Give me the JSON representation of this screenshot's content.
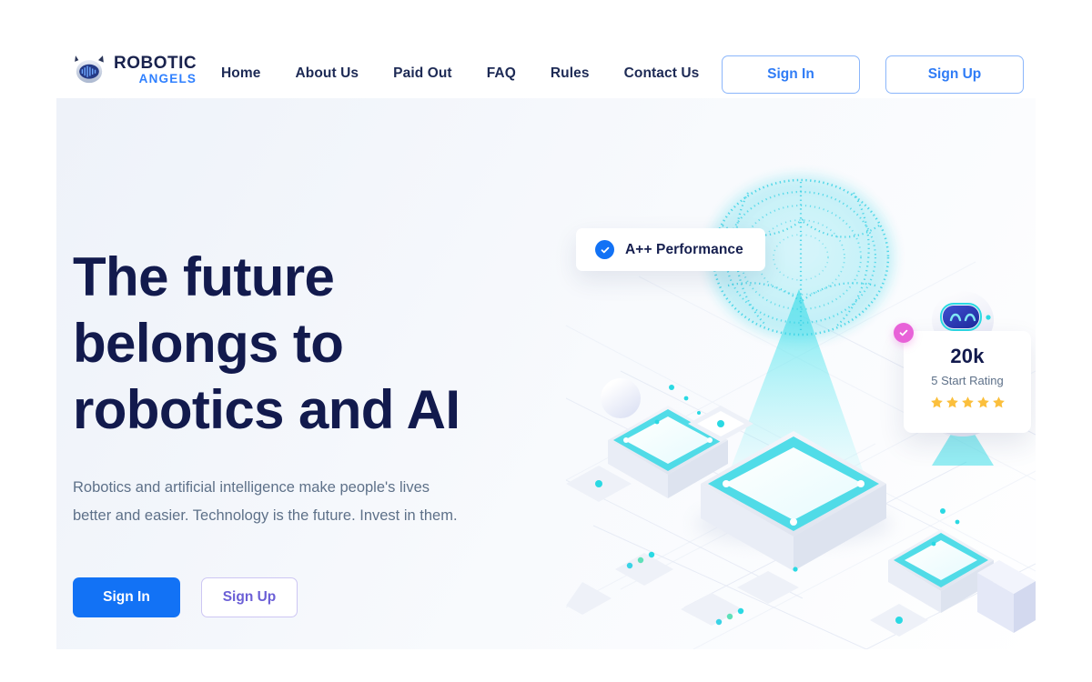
{
  "brand": {
    "name_top": "ROBOTIC",
    "name_bottom": "ANGELS",
    "icon": "robot-head-icon",
    "color_top": "#19224d",
    "color_bottom": "#2f80ff"
  },
  "nav": {
    "items": [
      {
        "label": "Home"
      },
      {
        "label": "About Us"
      },
      {
        "label": "Paid Out"
      },
      {
        "label": "FAQ"
      },
      {
        "label": "Rules"
      },
      {
        "label": "Contact Us"
      }
    ]
  },
  "header_actions": {
    "sign_in": "Sign In",
    "sign_up": "Sign Up"
  },
  "hero": {
    "title_line1": "The future",
    "title_line2": "belongs to",
    "title_line3": "robotics and AI",
    "paragraph_line1": "Robotics and artificial intelligence make people's lives",
    "paragraph_line2": "better and easier. Technology is the future. Invest in them.",
    "cta_primary": "Sign In",
    "cta_secondary": "Sign Up",
    "title_color": "#121a4d",
    "paragraph_color": "#5e7189",
    "primary_button_color": "#1272f5",
    "secondary_button_border": "#cdc6f3",
    "secondary_button_text": "#6b5fd6"
  },
  "performance_badge": {
    "label": "A++ Performance",
    "icon": "check-circle-icon",
    "icon_color": "#1272f5"
  },
  "rating_card": {
    "value": "20k",
    "label": "5 Start Rating",
    "stars": 5,
    "star_color": "#fbbf3c",
    "verified_icon": "check-badge-icon",
    "verified_color": "#e862d8"
  },
  "illustration": {
    "name": "ai-brain-hologram-illustration",
    "elements": [
      "dotted-brain-hologram",
      "cyan-light-cone",
      "isometric-platform-large",
      "isometric-platform-small",
      "floating-robot",
      "decorative-sphere",
      "decorative-cube",
      "grid-floor"
    ],
    "accent_color": "#2ad9e3",
    "brain_color": "#35d6e8"
  }
}
